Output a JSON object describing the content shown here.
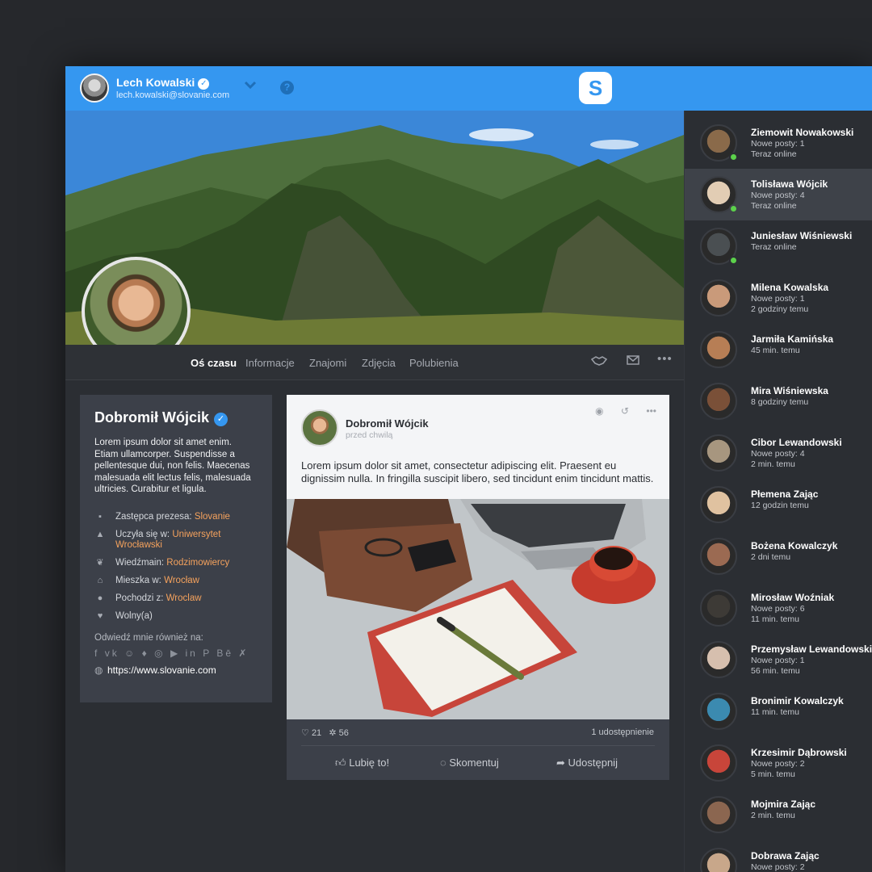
{
  "header": {
    "user_name": "Lech Kowalski",
    "user_email": "lech.kowalski@slovanie.com",
    "logo_letter": "S"
  },
  "tabs": [
    {
      "label": "Oś czasu",
      "active": true
    },
    {
      "label": "Informacje"
    },
    {
      "label": "Znajomi"
    },
    {
      "label": "Zdjęcia"
    },
    {
      "label": "Polubienia"
    }
  ],
  "tab_icons": [
    "handshake-icon",
    "mail-icon",
    "more-icon"
  ],
  "profile": {
    "name": "Dobromił Wójcik",
    "bio": "Lorem ipsum dolor sit amet enim. Etiam ullamcorper. Suspendisse a pellentesque dui, non felis. Maecenas malesuada elit lectus felis, malesuada ultricies. Curabitur et ligula.",
    "info": [
      {
        "icon": "briefcase-icon",
        "label": "Zastępca prezesa:",
        "value": "Slovanie"
      },
      {
        "icon": "graduation-cap-icon",
        "label": "Uczyła się w:",
        "value": "Uniwersytet Wrocławski"
      },
      {
        "icon": "leaf-icon",
        "label": "Wiedźmain:",
        "value": "Rodzimowiercy"
      },
      {
        "icon": "home-icon",
        "label": "Mieszka w:",
        "value": "Wrocław"
      },
      {
        "icon": "location-icon",
        "label": "Pochodzi z:",
        "value": "Wroclaw"
      },
      {
        "icon": "heart-icon",
        "label": "Wolny(a)",
        "value": ""
      }
    ],
    "visit_label": "Odwiedź mnie również na:",
    "social_icons": [
      "facebook-icon",
      "vk-icon",
      "snapchat-icon",
      "twitter-icon",
      "instagram-icon",
      "youtube-icon",
      "linkedin-icon",
      "pinterest-icon",
      "behance-icon",
      "xing-icon"
    ],
    "website": "https://www.slovanie.com"
  },
  "post": {
    "author": "Dobromił Wójcik",
    "time": "przed chwilą",
    "text": "Lorem ipsum dolor sit amet, consectetur adipiscing elit. Praesent eu dignissim nulla. In fringilla suscipit libero, sed tincidunt enim tincidunt mattis.",
    "likes": "21",
    "reactions": "56",
    "shares": "1 udostępnienie",
    "like_label": "Lubię to!",
    "comment_label": "Skomentuj",
    "share_label": "Udostępnij"
  },
  "friends": [
    {
      "name": "Ziemowit Nowakowski",
      "line1": "Nowe posty: 1",
      "line2": "Teraz online",
      "online": true,
      "color": "#8a6a4a"
    },
    {
      "name": "Tolisława Wójcik",
      "line1": "Nowe posty: 4",
      "line2": "Teraz online",
      "online": true,
      "active": true,
      "color": "#e2cdb4"
    },
    {
      "name": "Juniesław Wiśniewski",
      "line1": "Teraz online",
      "line2": "",
      "online": true,
      "color": "#4a4f52"
    },
    {
      "name": "Milena Kowalska",
      "line1": "Nowe posty: 1",
      "line2": "2 godziny temu",
      "color": "#c99a7a"
    },
    {
      "name": "Jarmiła Kamińska",
      "line1": "45 min. temu",
      "line2": "",
      "color": "#b77e55"
    },
    {
      "name": "Mira Wiśniewska",
      "line1": "8 godziny temu",
      "line2": "",
      "color": "#7a5038"
    },
    {
      "name": "Cibor Lewandowski",
      "line1": "Nowe posty: 4",
      "line2": "2 min. temu",
      "color": "#a7967f"
    },
    {
      "name": "Płemena Zając",
      "line1": "12 godzin temu",
      "line2": "",
      "color": "#e0c2a0"
    },
    {
      "name": "Bożena Kowalczyk",
      "line1": "2 dni temu",
      "line2": "",
      "color": "#9b6a52"
    },
    {
      "name": "Mirosław Woźniak",
      "line1": "Nowe posty: 6",
      "line2": "11 min. temu",
      "color": "#3d3a36"
    },
    {
      "name": "Przemysław Lewandowski",
      "line1": "Nowe posty: 1",
      "line2": "56 min. temu",
      "color": "#d6bfae"
    },
    {
      "name": "Bronimir Kowalczyk",
      "line1": "11 min. temu",
      "line2": "",
      "color": "#3b8ab0"
    },
    {
      "name": "Krzesimir Dąbrowski",
      "line1": "Nowe posty: 2",
      "line2": "5 min. temu",
      "color": "#c8453a"
    },
    {
      "name": "Mojmira Zając",
      "line1": "2 min. temu",
      "line2": "",
      "color": "#8b6650"
    },
    {
      "name": "Dobrawa Zając",
      "line1": "Nowe posty: 2",
      "line2": "",
      "color": "#c8a78a"
    }
  ]
}
